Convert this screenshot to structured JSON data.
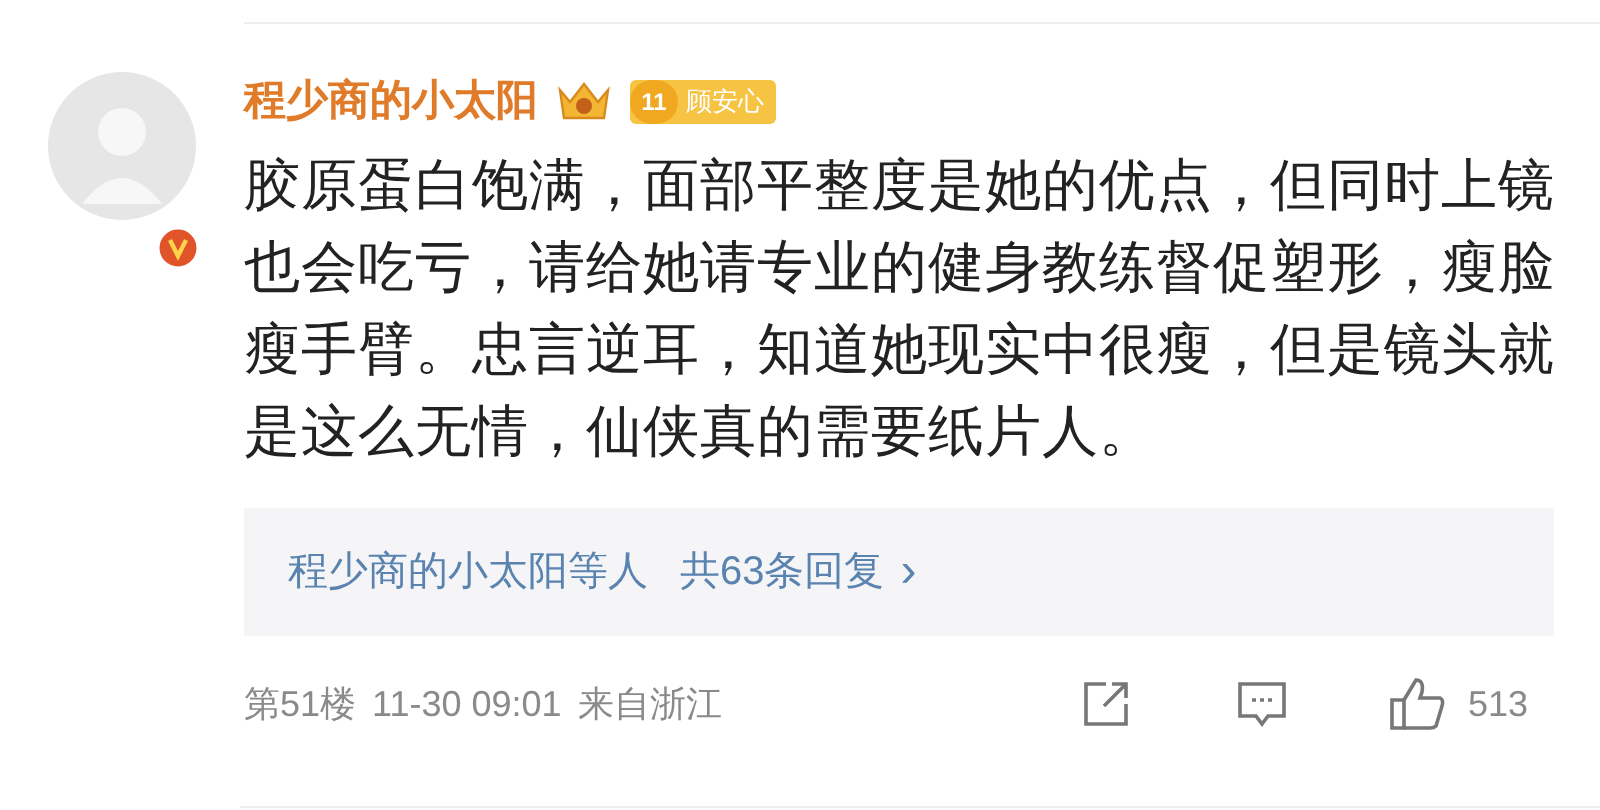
{
  "comment": {
    "username": "程少商的小太阳",
    "verified": true,
    "fan_badge": {
      "level": "11",
      "label": "顾安心"
    },
    "text": "胶原蛋白饱满，面部平整度是她的优点，但同时上镜也会吃亏，请给她请专业的健身教练督促塑形，瘦脸瘦手臂。忠言逆耳，知道她现实中很瘦，但是镜头就是这么无情，仙侠真的需要纸片人。",
    "replies": {
      "names": "程少商的小太阳等人",
      "count": "共63条回复",
      "arrow": "›"
    },
    "floor": "第51楼",
    "time": "11-30 09:01",
    "location": "来自浙江",
    "likes": "513"
  }
}
